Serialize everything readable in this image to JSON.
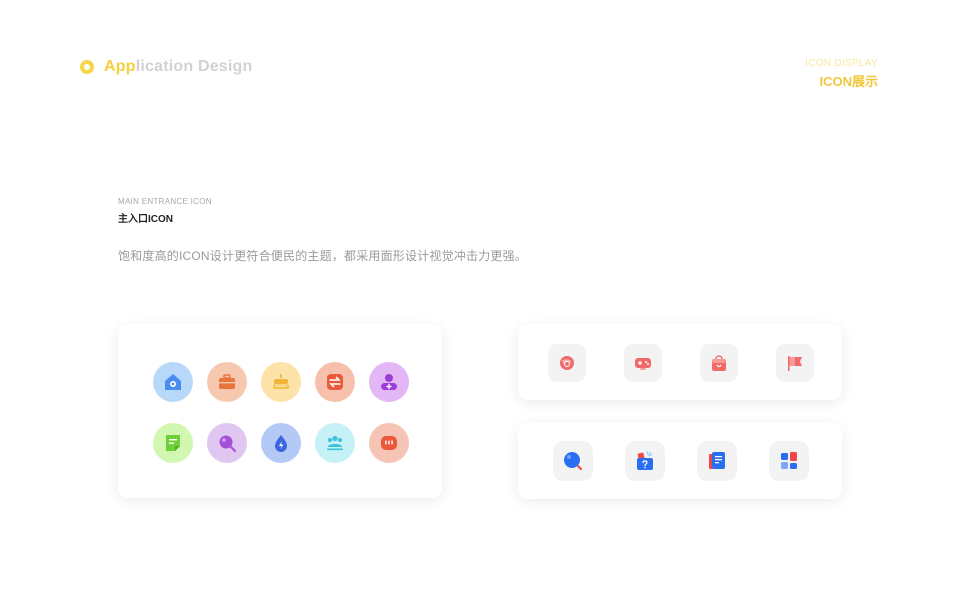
{
  "header": {
    "brand_accent": "App",
    "brand_rest": "lication Design",
    "corner_en": "ICON DISPLAY",
    "corner_cn": "ICON展示"
  },
  "section": {
    "label_en": "MAIN ENTRANCE ICON",
    "label_cn": "主入口ICON",
    "description": "饱和度高的ICON设计更符合便民的主题，都采用面形设计视觉冲击力更强。"
  },
  "colors": {
    "accent": "#f5cf3c",
    "brand_gray": "#d2d2d2",
    "card_bg": "#ffffff",
    "tile_bg": "#f3f3f4"
  },
  "icons": {
    "round_row1": [
      "home-icon",
      "briefcase-icon",
      "cake-icon",
      "exchange-icon",
      "add-user-icon"
    ],
    "round_row2": [
      "note-icon",
      "search-icon",
      "water-drop-icon",
      "group-icon",
      "chat-icon"
    ],
    "square_top": [
      "candy-icon",
      "gamepad-icon",
      "shopping-bag-icon",
      "flag-icon"
    ],
    "square_bottom": [
      "balloon-search-icon",
      "help-box-icon",
      "book-icon",
      "apps-icon"
    ]
  }
}
